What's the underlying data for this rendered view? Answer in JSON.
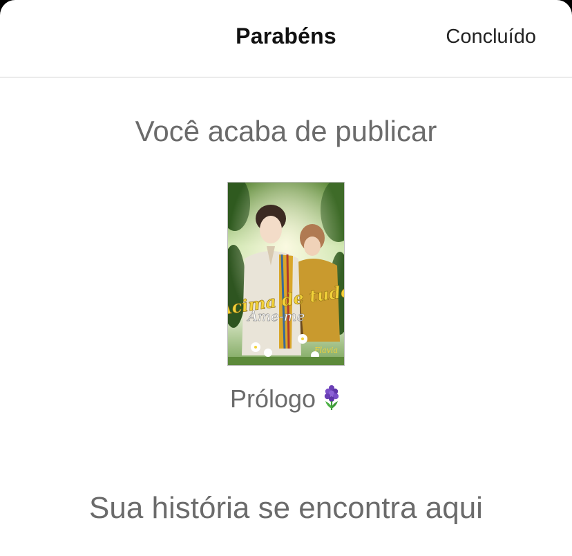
{
  "header": {
    "title": "Parabéns",
    "done_label": "Concluído"
  },
  "main": {
    "headline": "Você acaba de publicar",
    "cover": {
      "title_art": "Acima de tudo",
      "subtitle_art": "Ame-me",
      "author_art": "Flavia"
    },
    "chapter_title": "Prólogo",
    "chapter_emoji": "hyacinth-icon",
    "footer": "Sua história se encontra aqui"
  },
  "colors": {
    "background": "#ffffff",
    "title": "#111111",
    "muted_text": "#6b6b6b",
    "divider": "#cfcfcf"
  }
}
